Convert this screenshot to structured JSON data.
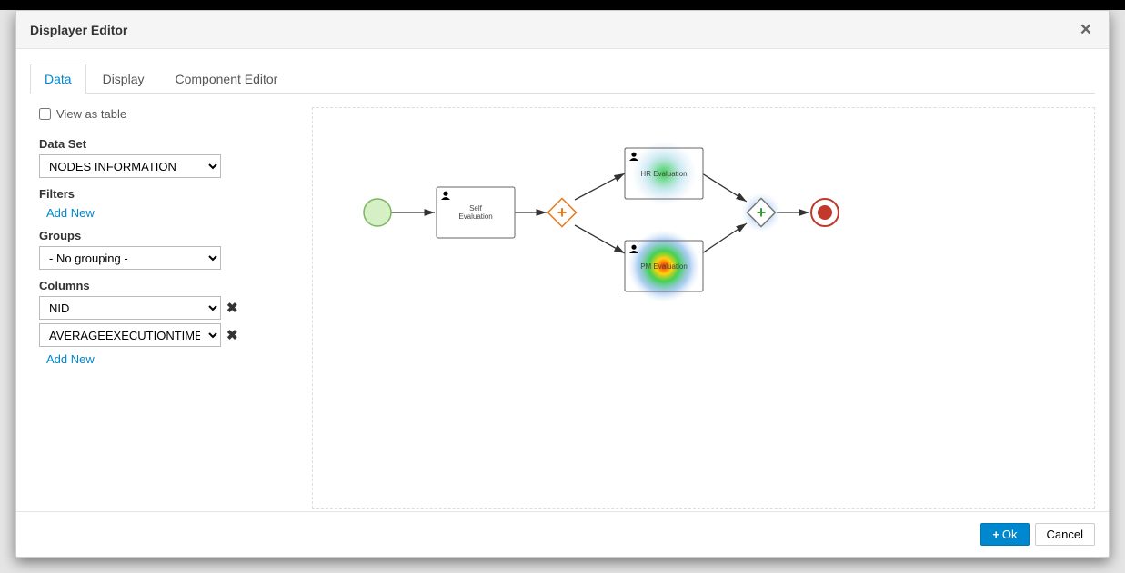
{
  "modal": {
    "title": "Displayer Editor",
    "close_symbol": "×"
  },
  "tabs": {
    "data": "Data",
    "display": "Display",
    "component": "Component Editor"
  },
  "form": {
    "view_as_table": "View as table",
    "data_set_label": "Data Set",
    "data_set_value": "NODES INFORMATION",
    "filters_label": "Filters",
    "add_new": "Add New",
    "groups_label": "Groups",
    "groups_value": "- No grouping -",
    "columns_label": "Columns",
    "col1_value": "NID",
    "col2_value": "AVERAGEEXECUTIONTIME",
    "remove_symbol": "✖"
  },
  "diagram": {
    "task_self": "Self Evaluation",
    "task_hr": "HR Evaluation",
    "task_pm": "PM Evaluation"
  },
  "footer": {
    "ok": "Ok",
    "cancel": "Cancel",
    "plus": "+"
  }
}
